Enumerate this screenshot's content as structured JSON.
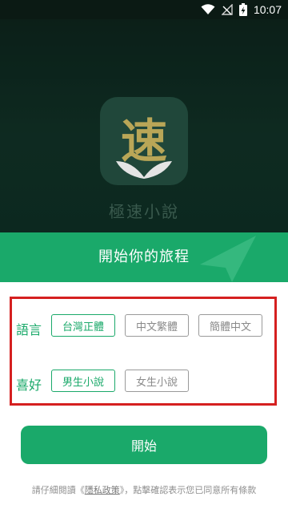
{
  "status_bar": {
    "time": "10:07",
    "icons": [
      "wifi-icon",
      "no-signal-icon",
      "battery-charging-icon"
    ]
  },
  "splash": {
    "logo_char": "速",
    "app_name": "極速小說",
    "logo_icon": "book-leaf-icon"
  },
  "banner": {
    "title": "開始你的旅程",
    "decoration_icon": "paper-plane-icon"
  },
  "language": {
    "label": "語言",
    "options": [
      {
        "label": "台灣正體",
        "selected": true
      },
      {
        "label": "中文繁體",
        "selected": false
      },
      {
        "label": "簡體中文",
        "selected": false
      }
    ]
  },
  "preference": {
    "label": "喜好",
    "options": [
      {
        "label": "男生小說",
        "selected": true
      },
      {
        "label": "女生小說",
        "selected": false
      }
    ]
  },
  "start_button": {
    "label": "開始"
  },
  "policy": {
    "prefix": "請仔細閱讀《",
    "link": "隱私政策",
    "suffix": "》，點擊確認表示您已同意所有條款"
  },
  "colors": {
    "accent": "#1aa96a",
    "highlight": "#d52020",
    "splash_bg": "#13392c"
  }
}
